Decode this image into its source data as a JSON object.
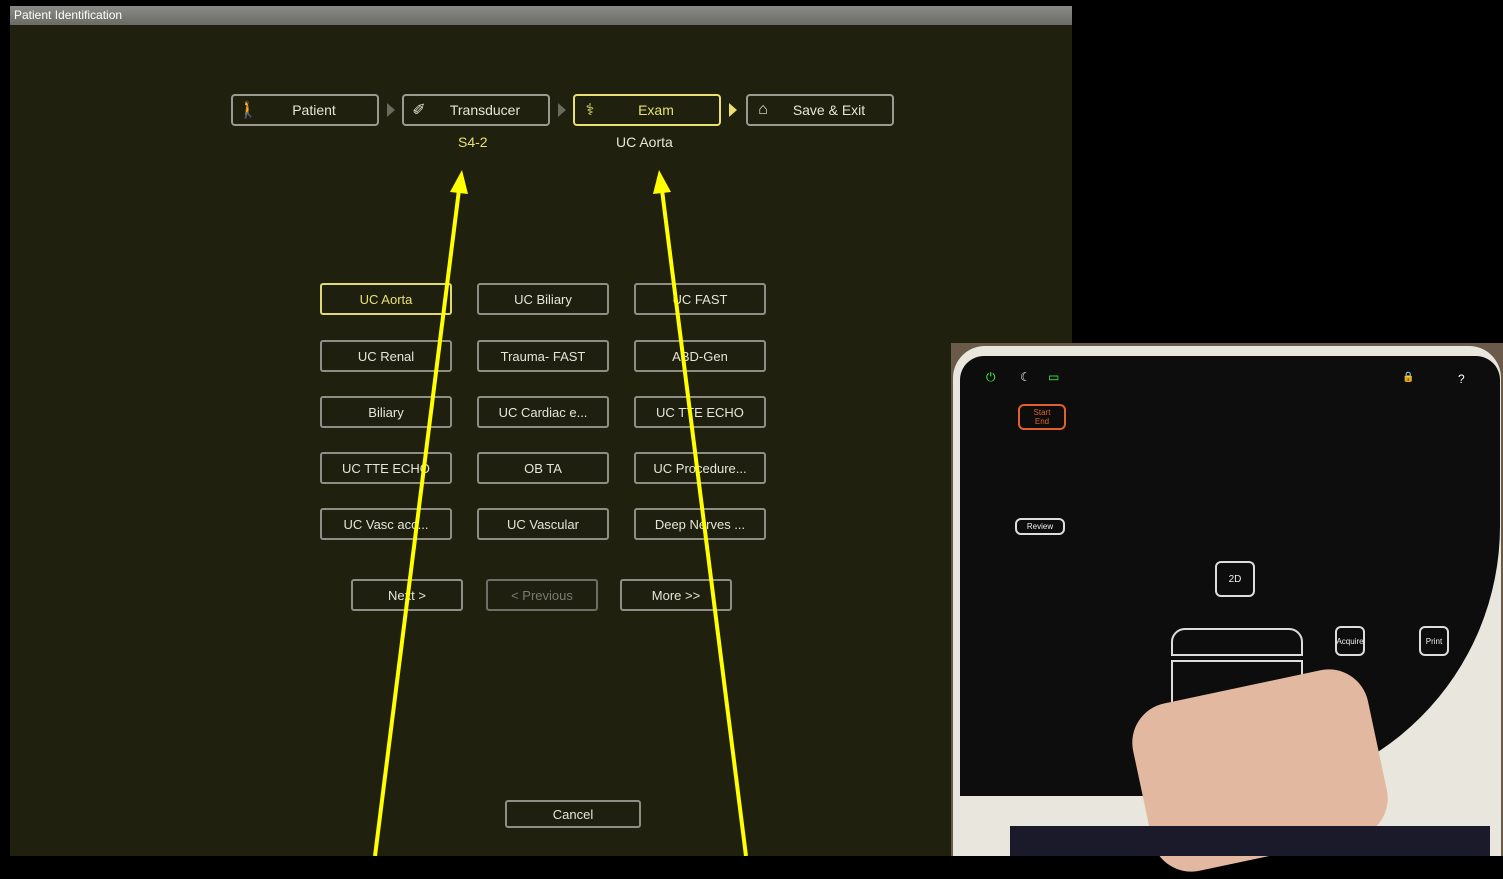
{
  "window": {
    "title": "Patient Identification"
  },
  "steps": [
    {
      "label": "Patient",
      "icon": "person-icon"
    },
    {
      "label": "Transducer",
      "icon": "transducer-icon"
    },
    {
      "label": "Exam",
      "icon": "exam-icon"
    },
    {
      "label": "Save & Exit",
      "icon": "save-exit-icon"
    }
  ],
  "selected": {
    "transducer": "S4-2",
    "exam": "UC Aorta"
  },
  "exams": [
    "UC Aorta",
    "UC Biliary",
    "UC FAST",
    "UC Renal",
    "Trauma- FAST",
    "ABD-Gen",
    "Biliary",
    "UC Cardiac e...",
    "UC TTE ECHO",
    "UC TTE ECHO",
    "OB TA",
    "UC Procedure...",
    "UC Vasc acc...",
    "UC Vascular",
    "Deep Nerves ..."
  ],
  "nav": {
    "next": "Next >",
    "previous": "< Previous",
    "more": "More >>"
  },
  "cancel": "Cancel",
  "controller": {
    "start": "Start",
    "end": "End",
    "review": "Review",
    "mode_2d": "2D",
    "acquire": "Acquire",
    "print": "Print"
  },
  "colors": {
    "accent": "#e8e070",
    "annotation": "#ffff00",
    "background": "#20200f"
  }
}
